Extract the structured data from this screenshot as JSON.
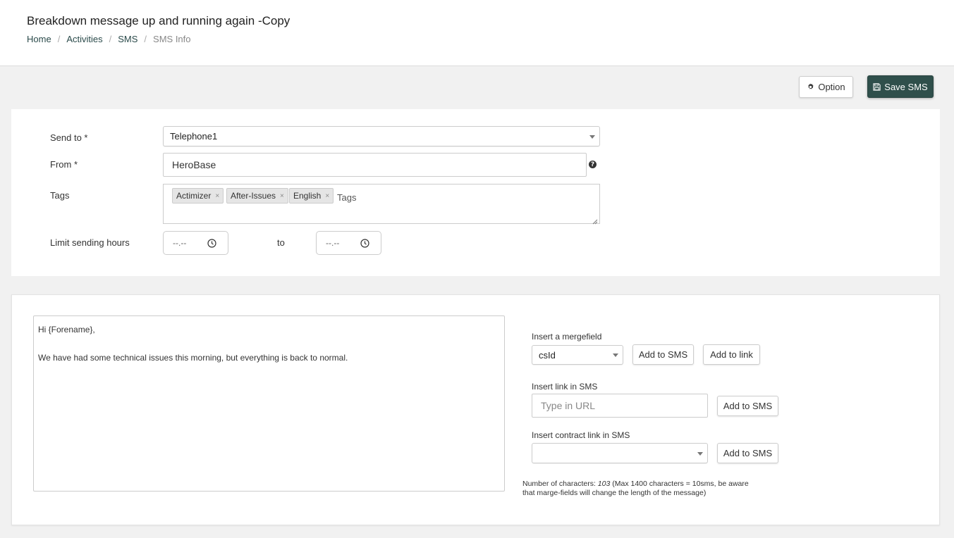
{
  "header": {
    "title": "Breakdown message up and running again -Copy",
    "breadcrumb": [
      {
        "label": "Home"
      },
      {
        "label": "Activities"
      },
      {
        "label": "SMS"
      },
      {
        "label": "SMS Info"
      }
    ]
  },
  "toolbar": {
    "option_label": "Option",
    "save_label": "Save SMS",
    "option_icon": "gear-icon",
    "save_icon": "floppy-disk-icon"
  },
  "form": {
    "send_to": {
      "label": "Send to *",
      "value": "Telephone1"
    },
    "from": {
      "label": "From *",
      "value": "HeroBase",
      "help": "?"
    },
    "tags": {
      "label": "Tags",
      "items": [
        "Actimizer",
        "After-Issues",
        "English"
      ],
      "remove_glyph": "×",
      "placeholder": "Tags"
    },
    "limit_hours": {
      "label": "Limit sending hours",
      "from_value": "--.--",
      "to_label": "to",
      "to_value": "--.--"
    }
  },
  "message": {
    "line1": "Hi {Forename},",
    "line2": "",
    "line3": "We have had some technical issues this morning, but everything is back to normal."
  },
  "side": {
    "mergefield": {
      "label": "Insert a mergefield",
      "value": "csId",
      "add_sms": "Add to SMS",
      "add_link": "Add to link"
    },
    "link": {
      "label": "Insert link in SMS",
      "placeholder": "Type in URL",
      "add_sms": "Add to SMS"
    },
    "contract": {
      "label": "Insert contract link in SMS",
      "value": "",
      "add_sms": "Add to SMS"
    },
    "char_info": {
      "prefix": "Number of characters: ",
      "count": "103",
      "suffix": " (Max 1400 characters = 10sms, be aware that marge-fields will change the length of the message)"
    }
  },
  "colors": {
    "primary_button": "#2f4f4b",
    "page_background": "#f1f1f1",
    "link": "#2a4a4a"
  }
}
